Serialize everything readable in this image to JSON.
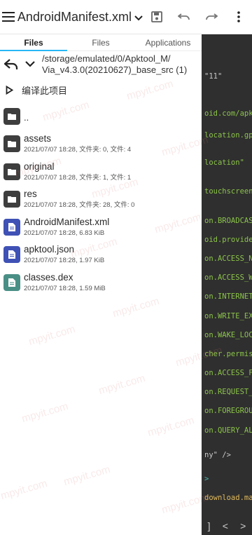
{
  "appbar": {
    "title": "AndroidManifest.xml",
    "menu_icon": "hamburger-menu-icon",
    "dropdown_icon": "caret-down-icon",
    "save_icon": "save-icon",
    "undo_icon": "undo-icon",
    "redo_icon": "redo-icon",
    "more_icon": "more-vert-icon"
  },
  "tabs": [
    {
      "label": "Files",
      "active": true
    },
    {
      "label": "Files",
      "active": false
    },
    {
      "label": "Applications",
      "active": false
    }
  ],
  "pathbar": {
    "path_line1": "/storage/emulated/0/Apktool_M/",
    "path_line2": "Via_v4.3.0(20210627)_base_src (1)"
  },
  "compile": {
    "label": "编译此项目"
  },
  "files": [
    {
      "name": "..",
      "meta": "",
      "type": "folder"
    },
    {
      "name": "assets",
      "meta": "2021/07/07 18:28, 文件夹: 0, 文件: 4",
      "type": "folder"
    },
    {
      "name": "original",
      "meta": "2021/07/07 18:28, 文件夹: 1, 文件: 1",
      "type": "folder"
    },
    {
      "name": "res",
      "meta": "2021/07/07 18:28, 文件夹: 28, 文件: 0",
      "type": "folder"
    },
    {
      "name": "AndroidManifest.xml",
      "meta": "2021/07/07 18:28, 6.83 KiB",
      "type": "xml"
    },
    {
      "name": "apktool.json",
      "meta": "2021/07/07 18:28, 1.97 KiB",
      "type": "json"
    },
    {
      "name": "classes.dex",
      "meta": "2021/07/07 18:28, 1.59 MiB",
      "type": "dex"
    }
  ],
  "editor_lines": [
    "\"11\"",
    "oid.com/apk/",
    "location.gp",
    "location\"",
    "touchscreen",
    "on.BROADCAS",
    "oid.provider",
    "on.ACCESS_NE",
    "on.ACCESS_WI",
    "on.INTERNET",
    "on.WRITE_EXT",
    "on.WAKE_LOCK",
    "cher.permiss",
    "on.ACCESS_FI",
    "on.REQUEST_I",
    "on.FOREGROUN",
    "on.QUERY_ALL",
    "ny\" />",
    ">",
    "download.ma"
  ],
  "editor_nav": {
    "bracket": "]",
    "prev": "<",
    "next": ">"
  },
  "watermark": "mpyit.com"
}
